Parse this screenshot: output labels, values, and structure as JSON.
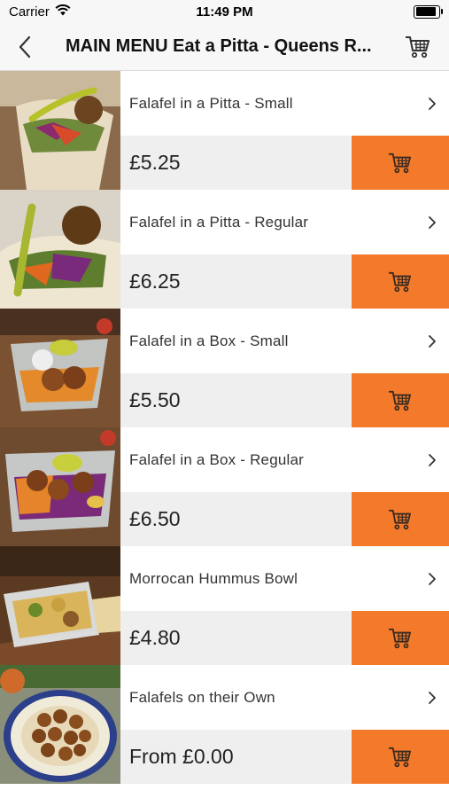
{
  "status": {
    "carrier": "Carrier",
    "time": "11:49 PM"
  },
  "nav": {
    "title": "MAIN MENU Eat a Pitta - Queens R..."
  },
  "colors": {
    "accent": "#f47a2b",
    "price_bg": "#efefef",
    "nav_bg": "#f7f7f7"
  },
  "items": [
    {
      "name": "Falafel in a Pitta - Small",
      "price": "£5.25"
    },
    {
      "name": "Falafel in a Pitta - Regular",
      "price": "£6.25"
    },
    {
      "name": "Falafel in a Box - Small",
      "price": "£5.50"
    },
    {
      "name": "Falafel in a Box - Regular",
      "price": "£6.50"
    },
    {
      "name": "Morrocan Hummus Bowl",
      "price": "£4.80"
    },
    {
      "name": "Falafels on their Own",
      "price": "From £0.00"
    }
  ]
}
